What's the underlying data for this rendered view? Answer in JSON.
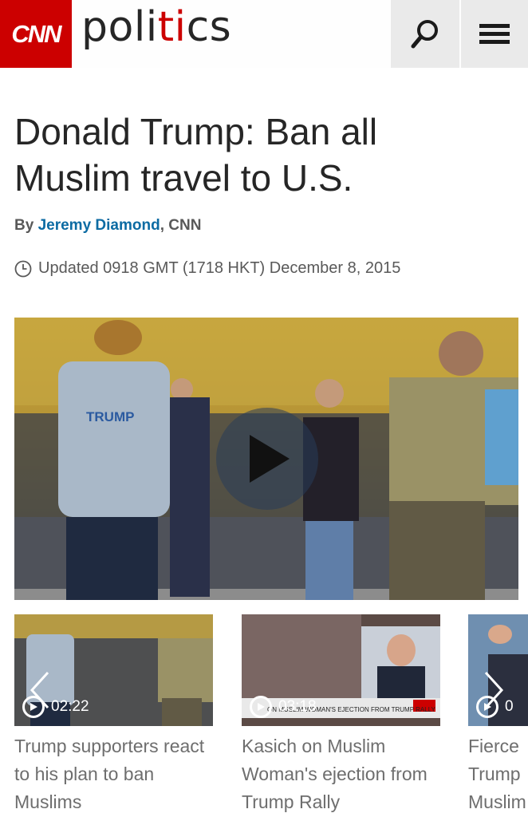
{
  "header": {
    "logo": "CNN",
    "section_pre": "poli",
    "section_accent": "ti",
    "section_post": "cs"
  },
  "article": {
    "headline": "Donald Trump: Ban all Muslim travel to U.S.",
    "by_prefix": "By ",
    "author": "Jeremy Diamond",
    "outlet": ", CNN",
    "updated": "Updated 0918 GMT (1718 HKT) December 8, 2015"
  },
  "main_video": {
    "shirt_text": "TRUMP"
  },
  "related_videos": [
    {
      "duration": "02:22",
      "caption": "Trump supporters react to his plan to ban Muslims"
    },
    {
      "duration": "03:18",
      "caption": "Kasich on Muslim Woman's ejection from Trump Rally"
    },
    {
      "duration": "0",
      "caption": "Fierce Trump Muslim"
    }
  ],
  "colors": {
    "brand": "#cc0000",
    "link": "#0c6ba3"
  },
  "icons": [
    "search-icon",
    "menu-icon",
    "clock-icon",
    "play-icon",
    "chevron-left-icon",
    "chevron-right-icon"
  ]
}
